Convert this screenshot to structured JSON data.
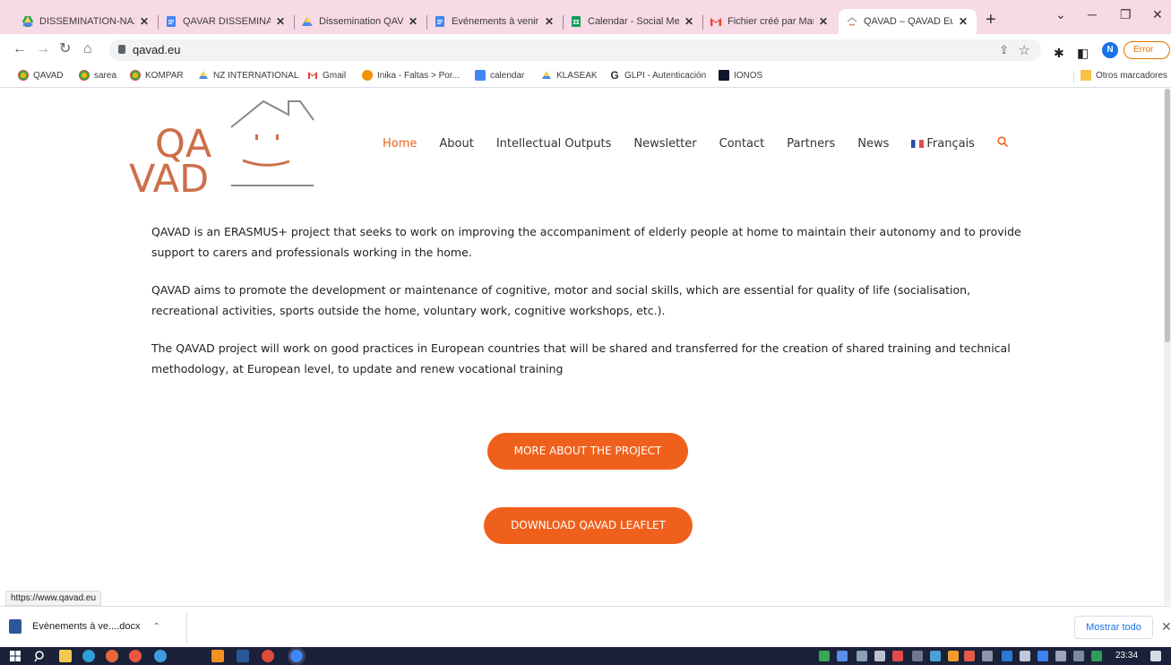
{
  "browser": {
    "tabs": [
      {
        "title": "DISSEMINATION-NAZ",
        "icon": "google-drive-icon"
      },
      {
        "title": "QAVAR DISSEMINATIO",
        "icon": "google-docs-icon"
      },
      {
        "title": "Dissemination QAVAD",
        "icon": "google-drive-icon"
      },
      {
        "title": "Evénements à venir et",
        "icon": "google-docs-icon"
      },
      {
        "title": "Calendar - Social Med",
        "icon": "google-sheets-icon"
      },
      {
        "title": "Fichier créé par Marin",
        "icon": "gmail-icon"
      },
      {
        "title": "QAVAD – QAVAD Euro",
        "icon": "qavad-favicon",
        "active": true
      }
    ],
    "new_tab": "+",
    "url": "qavad.eu",
    "error_label": "Error",
    "profile_initial": "N",
    "bookmarks": [
      {
        "label": "QAVAD",
        "icon": "colorful-star-icon"
      },
      {
        "label": "sarea",
        "icon": "colorful-star-icon"
      },
      {
        "label": "KOMPAR",
        "icon": "colorful-star-icon"
      },
      {
        "label": "NZ INTERNATIONAL",
        "icon": "google-drive-icon"
      },
      {
        "label": "Gmail",
        "icon": "gmail-icon"
      },
      {
        "label": "Inika - Faltas > Por...",
        "icon": "orange-circle-icon"
      },
      {
        "label": "calendar",
        "icon": "calendar-icon"
      },
      {
        "label": "KLASEAK",
        "icon": "google-drive-icon"
      },
      {
        "label": "GLPI - Autenticación",
        "icon": "glpi-icon"
      },
      {
        "label": "IONOS",
        "icon": "ionos-icon"
      }
    ],
    "other_bookmarks": "Otros marcadores",
    "status_url": "https://www.qavad.eu"
  },
  "site": {
    "logo": {
      "line1": "QA",
      "line2": "VAD"
    },
    "nav": [
      {
        "label": "Home",
        "current": true
      },
      {
        "label": "About"
      },
      {
        "label": "Intellectual Outputs"
      },
      {
        "label": "Newsletter"
      },
      {
        "label": "Contact"
      },
      {
        "label": "Partners"
      },
      {
        "label": "News"
      },
      {
        "label": "Français",
        "flag": "fr-flag-icon"
      }
    ],
    "paragraphs": [
      "QAVAD is an ERASMUS+ project that seeks to work on improving the accompaniment of elderly people at home to maintain their autonomy and to provide support to carers and professionals working in the home.",
      "QAVAD aims to promote the development or maintenance of cognitive, motor and social skills, which are essential for quality of life (socialisation, recreational activities, sports outside the home, voluntary work, cognitive workshops, etc.).",
      "The QAVAD project will work on good practices in European countries that will be shared and transferred for the creation of shared training and technical methodology, at European level, to update and renew vocational training"
    ],
    "cta_more": "MORE ABOUT THE PROJECT",
    "cta_leaflet": "DOWNLOAD QAVAD LEAFLET",
    "accent_color": "#f0601d"
  },
  "downloads": {
    "file": "Evènements à ve....docx",
    "show_all": "Mostrar todo"
  },
  "taskbar": {
    "time": "23:34"
  }
}
